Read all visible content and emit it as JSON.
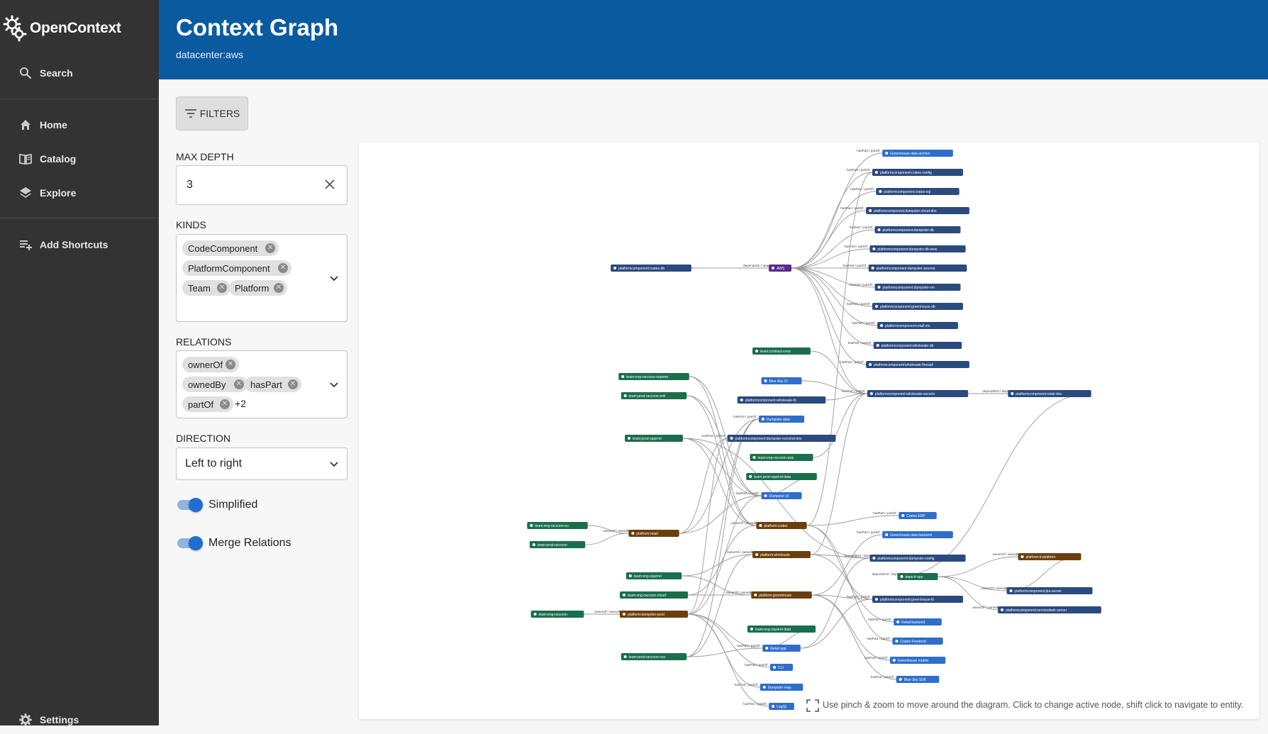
{
  "sidebar": {
    "logo_text": "OpenContext",
    "search_label": "Search",
    "items": [
      {
        "label": "Home",
        "icon": "home-icon"
      },
      {
        "label": "Catalog",
        "icon": "catalog-icon"
      },
      {
        "label": "Explore",
        "icon": "layers-icon"
      }
    ],
    "add_shortcuts_label": "Add Shortcuts",
    "settings_label": "Settings"
  },
  "header": {
    "title": "Context Graph",
    "subtitle": "datacenter:aws"
  },
  "filters": {
    "button_label": "FILTERS",
    "max_depth_label": "MAX DEPTH",
    "max_depth_value": "3",
    "kinds_label": "KINDS",
    "kinds": [
      "CodeComponent",
      "PlatformComponent",
      "Team",
      "Platform"
    ],
    "relations_label": "RELATIONS",
    "relations": [
      "ownerOf",
      "ownedBy",
      "hasPart",
      "partOf"
    ],
    "relations_more": "+2",
    "direction_label": "DIRECTION",
    "direction_value": "Left to right",
    "simplified_label": "Simplified",
    "simplified_on": true,
    "merge_label": "Merge Relations",
    "merge_on": true
  },
  "graph": {
    "hint": "Use pinch & zoom to move around the diagram. Click to change active node, shift click to navigate to entity.",
    "colors": {
      "platformcomponent": "#2b4a7e",
      "team": "#1b6e4c",
      "platform": "#6b3f0c",
      "code": "#2f6ec9",
      "datacenter": "#5b2b8f",
      "edge": "#9a9a9a"
    },
    "nodes": [
      {
        "id": "pc-crates-db",
        "label": "platformcomponent:crates-db",
        "kind": "platformcomponent"
      },
      {
        "id": "aws",
        "label": "AWS",
        "kind": "datacenter"
      },
      {
        "id": "gh-data-archive",
        "label": "Greenhouse data archive",
        "kind": "code"
      },
      {
        "id": "pc-crates-config",
        "label": "platformcomponent:crates-config",
        "kind": "platformcomponent"
      },
      {
        "id": "pc-crates-sql",
        "label": "platformcomponent:crates-sql",
        "kind": "platformcomponent"
      },
      {
        "id": "pc-dumpster-cloud-dns",
        "label": "platformcomponent:dumpster-cloud-dns",
        "kind": "platformcomponent"
      },
      {
        "id": "pc-dumpster-db",
        "label": "platformcomponent:dumpster-db",
        "kind": "platformcomponent"
      },
      {
        "id": "pc-dumpster-db-wew",
        "label": "platformcomponent:dumpster-db-wew",
        "kind": "platformcomponent"
      },
      {
        "id": "pc-dumpster-secrets",
        "label": "platformcomponent:dumpster-secrets",
        "kind": "platformcomponent"
      },
      {
        "id": "pc-dumpster-vm",
        "label": "platformcomponent:dumpster-vm",
        "kind": "platformcomponent"
      },
      {
        "id": "pc-greenhouse-db",
        "label": "platformcomponent:greenhouse-db",
        "kind": "platformcomponent"
      },
      {
        "id": "pc-retail-vm",
        "label": "platformcomponent:retail-vm",
        "kind": "platformcomponent"
      },
      {
        "id": "pc-wholesale-db",
        "label": "platformcomponent:wholesale-db",
        "kind": "platformcomponent"
      },
      {
        "id": "pc-wholesale-firewall",
        "label": "platformcomponent:wholesale-firewall",
        "kind": "platformcomponent"
      },
      {
        "id": "pc-wholesale-secrets",
        "label": "platformcomponent:wholesale-secrets",
        "kind": "platformcomponent"
      },
      {
        "id": "pc-retail-dns",
        "label": "platformcomponent:retail-dns",
        "kind": "platformcomponent"
      },
      {
        "id": "team-contract-crew",
        "label": "team:contract-crew",
        "kind": "team"
      },
      {
        "id": "blue-sky-ci",
        "label": "Blue Sky CI",
        "kind": "code"
      },
      {
        "id": "pc-wholesale-lb",
        "label": "platformcomponent:wholesale-lb",
        "kind": "platformcomponent"
      },
      {
        "id": "team-eng-raccoon-onprem",
        "label": "team:eng-raccoon-onprem",
        "kind": "team"
      },
      {
        "id": "team-prod-raccoon-eml",
        "label": "team:prod-raccoon-eml",
        "kind": "team"
      },
      {
        "id": "dumpster-data",
        "label": "Dumpster data",
        "kind": "code"
      },
      {
        "id": "team-prod-squirrel",
        "label": "team:prod-squirrel",
        "kind": "team"
      },
      {
        "id": "pc-dumpster-nonclod-dns",
        "label": "platformcomponent:dumpster-nonclod-dns",
        "kind": "platformcomponent"
      },
      {
        "id": "team-eng-raccoon-aws",
        "label": "team:eng-raccoon-aws",
        "kind": "team"
      },
      {
        "id": "team-prod-squirrel-data",
        "label": "team:prod-squirrel-data",
        "kind": "team"
      },
      {
        "id": "dumpster-ui",
        "label": "Dumpster UI",
        "kind": "code"
      },
      {
        "id": "crates-erp",
        "label": "Crates ERP",
        "kind": "code"
      },
      {
        "id": "team-eng-raccoon-eu",
        "label": "team:eng-raccoon-eu",
        "kind": "team"
      },
      {
        "id": "platform-crates",
        "label": "platform:crates",
        "kind": "platform"
      },
      {
        "id": "gh-data-backend",
        "label": "Greenhouse data backend",
        "kind": "code"
      },
      {
        "id": "platform-retail",
        "label": "platform:retail",
        "kind": "platform"
      },
      {
        "id": "team-prod-raccoon",
        "label": "team:prod-raccoon",
        "kind": "team"
      },
      {
        "id": "platform-wholesale",
        "label": "platform:wholesale",
        "kind": "platform"
      },
      {
        "id": "pc-dumpster-config",
        "label": "platformcomponent:dumpster-config",
        "kind": "platformcomponent"
      },
      {
        "id": "platform-it-platform",
        "label": "platform:it-platform",
        "kind": "platform"
      },
      {
        "id": "team-eng-squirrel",
        "label": "team:eng-squirrel",
        "kind": "team"
      },
      {
        "id": "team-it-ops",
        "label": "team:it-ops",
        "kind": "team"
      },
      {
        "id": "pc-jira-server",
        "label": "platformcomponent:jira-server",
        "kind": "platformcomponent"
      },
      {
        "id": "team-eng-raccoon-cloud",
        "label": "team:eng-raccoon-cloud",
        "kind": "team"
      },
      {
        "id": "platform-greenhouse",
        "label": "platform:greenhouse",
        "kind": "platform"
      },
      {
        "id": "pc-greenhouse-lb",
        "label": "platformcomponent:greenhouse-lb",
        "kind": "platformcomponent"
      },
      {
        "id": "pc-servicedesk-server",
        "label": "platformcomponent:servicedesk-server",
        "kind": "platformcomponent"
      },
      {
        "id": "team-eng-raccoon",
        "label": "team:eng-raccoon",
        "kind": "team"
      },
      {
        "id": "platform-dumpster-prod",
        "label": "platform:dumpster-prod",
        "kind": "platform"
      },
      {
        "id": "retail-backend",
        "label": "Retail backend",
        "kind": "code"
      },
      {
        "id": "team-eng-squirrel-data",
        "label": "team:eng-squirrel-data",
        "kind": "team"
      },
      {
        "id": "crates-frontend",
        "label": "Crates Frontend",
        "kind": "code"
      },
      {
        "id": "retail-app",
        "label": "Retail app",
        "kind": "code"
      },
      {
        "id": "greenhouse-mobile",
        "label": "Greenhouse mobile",
        "kind": "code"
      },
      {
        "id": "team-prod-raccoon-cex",
        "label": "team:prod-raccoon-cex",
        "kind": "team"
      },
      {
        "id": "cli",
        "label": "CLI",
        "kind": "code"
      },
      {
        "id": "blue-sky-sdk",
        "label": "Blue Sky SDK",
        "kind": "code"
      },
      {
        "id": "dumpster-map",
        "label": "Dumpster map",
        "kind": "code"
      },
      {
        "id": "logql",
        "label": "LogQL",
        "kind": "code"
      }
    ],
    "edge_labels": {
      "dependsOn": "dependsOn / dependencyOf",
      "hasPart": "hasPart / partOf",
      "ownerOf": "ownerOf / ownedBy"
    }
  }
}
